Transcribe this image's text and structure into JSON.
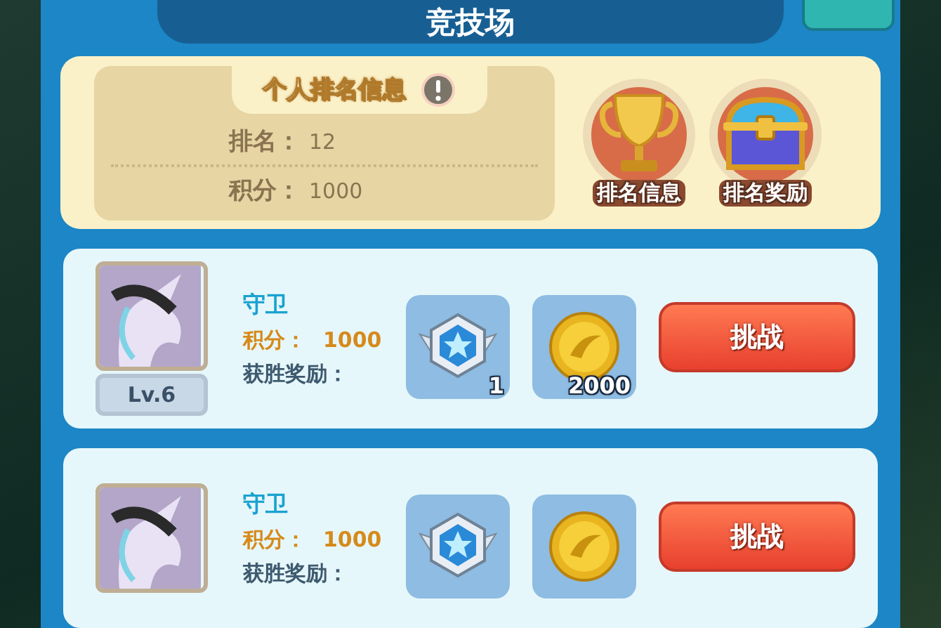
{
  "title": "竞技场",
  "personal": {
    "heading": "个人排名信息",
    "rows": [
      {
        "label": "排名：",
        "value": "12"
      },
      {
        "label": "积分：",
        "value": "1000"
      }
    ],
    "actions": [
      {
        "kind": "trophy",
        "label": "排名信息"
      },
      {
        "kind": "chest",
        "label": "排名奖励"
      }
    ]
  },
  "opponents": [
    {
      "name": "守卫",
      "score_label": "积分：",
      "score": "1000",
      "level": "Lv.6",
      "reward_label": "获胜奖励：",
      "rewards": [
        {
          "kind": "badge",
          "count": "1"
        },
        {
          "kind": "coin",
          "count": "2000"
        }
      ],
      "button": "挑战"
    },
    {
      "name": "守卫",
      "score_label": "积分：",
      "score": "1000",
      "reward_label": "获胜奖励：",
      "rewards": [
        {
          "kind": "badge"
        },
        {
          "kind": "coin"
        }
      ],
      "button": "挑战"
    }
  ]
}
